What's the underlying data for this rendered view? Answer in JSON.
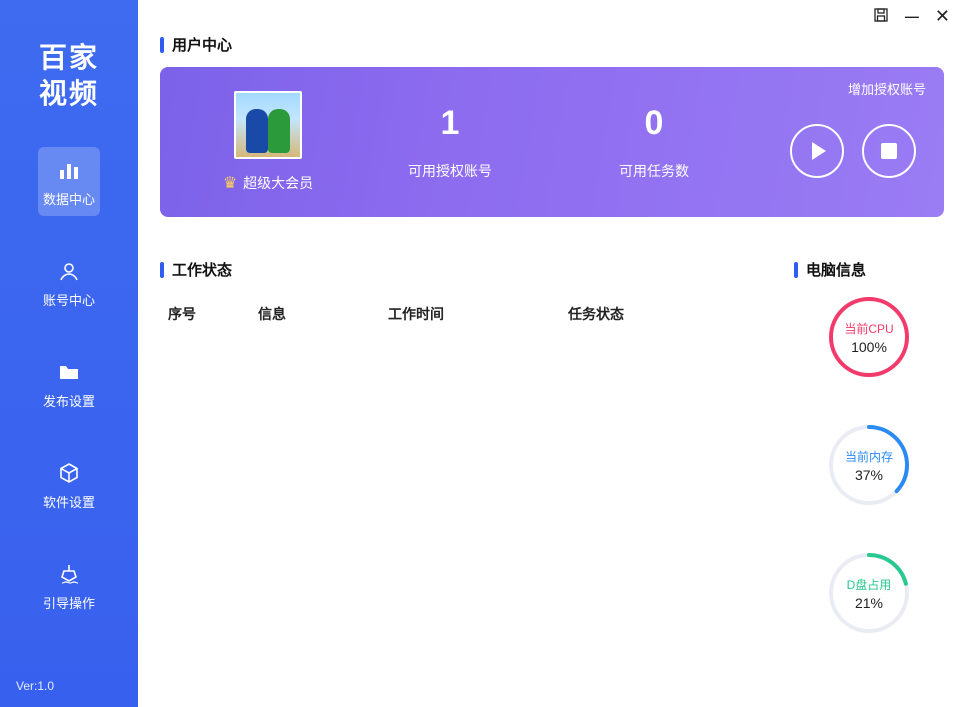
{
  "app": {
    "logo_line1": "百家",
    "logo_line2": "视频",
    "version": "Ver:1.0"
  },
  "nav": {
    "items": [
      {
        "id": "data",
        "label": "数据中心",
        "active": true
      },
      {
        "id": "account",
        "label": "账号中心",
        "active": false
      },
      {
        "id": "publish",
        "label": "发布设置",
        "active": false
      },
      {
        "id": "software",
        "label": "软件设置",
        "active": false
      },
      {
        "id": "guide",
        "label": "引导操作",
        "active": false
      }
    ]
  },
  "titlebar": {
    "save_icon": "save-icon",
    "min_icon": "minimize-icon",
    "close_icon": "close-icon"
  },
  "sections": {
    "user_center": "用户中心",
    "work_status": "工作状态",
    "pc_info": "电脑信息"
  },
  "hero": {
    "add_link": "增加授权账号",
    "member_label": "超级大会员",
    "stats": [
      {
        "value": "1",
        "caption": "可用授权账号"
      },
      {
        "value": "0",
        "caption": "可用任务数"
      }
    ]
  },
  "table": {
    "columns": [
      "序号",
      "信息",
      "工作时间",
      "任务状态"
    ],
    "rows": []
  },
  "gauges": {
    "cpu": {
      "label": "当前CPU",
      "value": 100,
      "display": "100%"
    },
    "mem": {
      "label": "当前内存",
      "value": 37,
      "display": "37%"
    },
    "disk": {
      "label": "D盘占用",
      "value": 21,
      "display": "21%"
    }
  },
  "chart_data": [
    {
      "type": "pie",
      "title": "当前CPU",
      "categories": [
        "used",
        "free"
      ],
      "values": [
        100,
        0
      ],
      "ylim": [
        0,
        100
      ]
    },
    {
      "type": "pie",
      "title": "当前内存",
      "categories": [
        "used",
        "free"
      ],
      "values": [
        37,
        63
      ],
      "ylim": [
        0,
        100
      ]
    },
    {
      "type": "pie",
      "title": "D盘占用",
      "categories": [
        "used",
        "free"
      ],
      "values": [
        21,
        79
      ],
      "ylim": [
        0,
        100
      ]
    }
  ]
}
